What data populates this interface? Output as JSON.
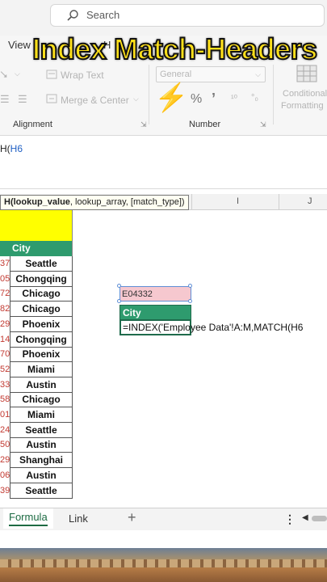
{
  "search": {
    "label": "Search"
  },
  "ribbon": {
    "view_tab": "View",
    "h_tab": "H",
    "wrap_text": "Wrap Text",
    "merge_center": "Merge & Center",
    "number_format": "General",
    "percent": "%",
    "comma": "’",
    "increase_decimal": "¹⁰",
    "decrease_decimal": "°₀",
    "conditional_formatting_line1": "Conditional",
    "conditional_formatting_line2": "Formatting",
    "alignment_group": "Alignment",
    "number_group": "Number"
  },
  "overlay": {
    "title": "Index Match-Headers"
  },
  "formula_bar": {
    "prefix": "H(",
    "ref": "H6"
  },
  "tooltip": {
    "text_bold": "H(lookup_value",
    "text_rest": ", lookup_array, [match_type])"
  },
  "columns": {
    "i": "I",
    "j": "J"
  },
  "table": {
    "header": "City",
    "rows": [
      {
        "num": "37",
        "city": "Seattle"
      },
      {
        "num": "05",
        "city": "Chongqing"
      },
      {
        "num": "72",
        "city": "Chicago"
      },
      {
        "num": "82",
        "city": "Chicago"
      },
      {
        "num": "29",
        "city": "Phoenix"
      },
      {
        "num": "14",
        "city": "Chongqing"
      },
      {
        "num": "70",
        "city": "Phoenix"
      },
      {
        "num": "52",
        "city": "Miami"
      },
      {
        "num": "33",
        "city": "Austin"
      },
      {
        "num": "58",
        "city": "Chicago"
      },
      {
        "num": "01",
        "city": "Miami"
      },
      {
        "num": "24",
        "city": "Seattle"
      },
      {
        "num": "50",
        "city": "Austin"
      },
      {
        "num": "29",
        "city": "Shanghai"
      },
      {
        "num": "06",
        "city": "Austin"
      },
      {
        "num": "39",
        "city": "Seattle"
      }
    ]
  },
  "lookup": {
    "employee_id": "E04332",
    "result_header": "City",
    "formula": "=INDEX('Employee Data'!A:M,MATCH(H6"
  },
  "sheet_tabs": {
    "active": "Formula",
    "second": "Link",
    "add": "+"
  },
  "colors": {
    "header_green": "#2e9b6e",
    "yellow": "#ffff00",
    "pink": "#f6c8cf",
    "title_yellow": "#ffe01a"
  }
}
